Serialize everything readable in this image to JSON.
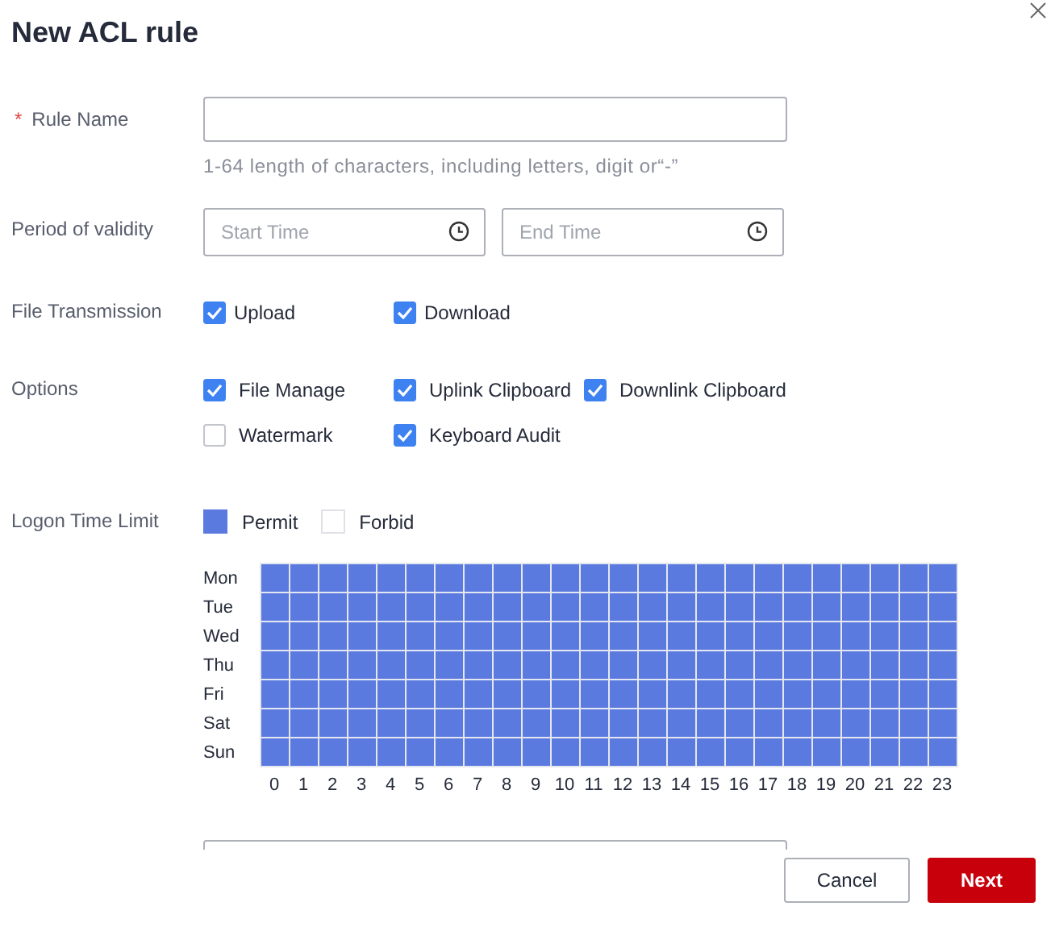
{
  "dialog": {
    "title": "New ACL rule"
  },
  "rule_name": {
    "label": "Rule Name",
    "required_mark": "*",
    "hint": "1-64 length of characters, including letters, digit or“-”"
  },
  "period": {
    "label": "Period of validity",
    "start": {
      "placeholder": "Start Time"
    },
    "end": {
      "placeholder": "End Time"
    }
  },
  "file_transmission": {
    "label": "File Transmission",
    "items": [
      {
        "label": "Upload",
        "checked": true
      },
      {
        "label": "Download",
        "checked": true
      }
    ]
  },
  "options": {
    "label": "Options",
    "items": [
      {
        "label": "File Manage",
        "checked": true
      },
      {
        "label": "Uplink Clipboard",
        "checked": true
      },
      {
        "label": "Downlink Clipboard",
        "checked": true
      },
      {
        "label": "Watermark",
        "checked": false
      },
      {
        "label": "Keyboard Audit",
        "checked": true
      }
    ]
  },
  "logon_time": {
    "label": "Logon Time Limit",
    "legend": [
      {
        "label": "Permit",
        "kind": "permit"
      },
      {
        "label": "Forbid",
        "kind": "forbid"
      }
    ],
    "days": [
      {
        "label": "Mon",
        "permitted": [
          true,
          true,
          true,
          true,
          true,
          true,
          true,
          true,
          true,
          true,
          true,
          true,
          true,
          true,
          true,
          true,
          true,
          true,
          true,
          true,
          true,
          true,
          true,
          true
        ]
      },
      {
        "label": "Tue",
        "permitted": [
          true,
          true,
          true,
          true,
          true,
          true,
          true,
          true,
          true,
          true,
          true,
          true,
          true,
          true,
          true,
          true,
          true,
          true,
          true,
          true,
          true,
          true,
          true,
          true
        ]
      },
      {
        "label": "Wed",
        "permitted": [
          true,
          true,
          true,
          true,
          true,
          true,
          true,
          true,
          true,
          true,
          true,
          true,
          true,
          true,
          true,
          true,
          true,
          true,
          true,
          true,
          true,
          true,
          true,
          true
        ]
      },
      {
        "label": "Thu",
        "permitted": [
          true,
          true,
          true,
          true,
          true,
          true,
          true,
          true,
          true,
          true,
          true,
          true,
          true,
          true,
          true,
          true,
          true,
          true,
          true,
          true,
          true,
          true,
          true,
          true
        ]
      },
      {
        "label": "Fri",
        "permitted": [
          true,
          true,
          true,
          true,
          true,
          true,
          true,
          true,
          true,
          true,
          true,
          true,
          true,
          true,
          true,
          true,
          true,
          true,
          true,
          true,
          true,
          true,
          true,
          true
        ]
      },
      {
        "label": "Sat",
        "permitted": [
          true,
          true,
          true,
          true,
          true,
          true,
          true,
          true,
          true,
          true,
          true,
          true,
          true,
          true,
          true,
          true,
          true,
          true,
          true,
          true,
          true,
          true,
          true,
          true
        ]
      },
      {
        "label": "Sun",
        "permitted": [
          true,
          true,
          true,
          true,
          true,
          true,
          true,
          true,
          true,
          true,
          true,
          true,
          true,
          true,
          true,
          true,
          true,
          true,
          true,
          true,
          true,
          true,
          true,
          true
        ]
      }
    ],
    "hours": [
      "0",
      "1",
      "2",
      "3",
      "4",
      "5",
      "6",
      "7",
      "8",
      "9",
      "10",
      "11",
      "12",
      "13",
      "14",
      "15",
      "16",
      "17",
      "18",
      "19",
      "20",
      "21",
      "22",
      "23"
    ]
  },
  "buttons": [
    {
      "label": "Cancel",
      "kind": "secondary"
    },
    {
      "label": "Next",
      "kind": "primary"
    }
  ]
}
